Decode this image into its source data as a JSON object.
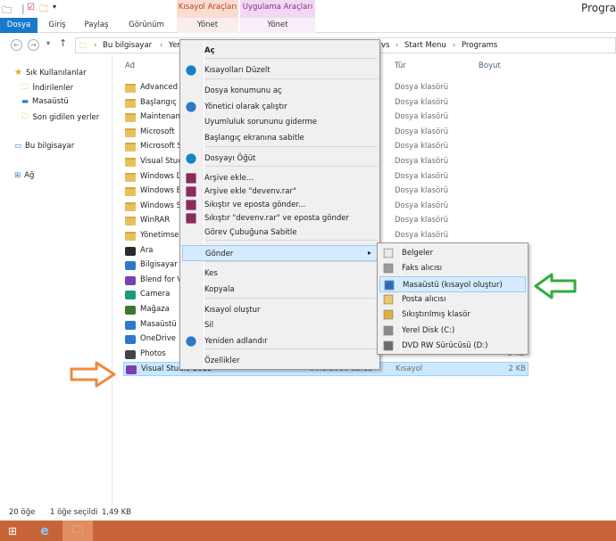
{
  "window": {
    "title": "Progra"
  },
  "ribbon": {
    "context1": "Kısayol Araçları",
    "context2": "Uygulama Araçları",
    "tabs": [
      "Dosya",
      "Giriş",
      "Paylaş",
      "Görünüm",
      "Yönet",
      "Yönet"
    ]
  },
  "address": {
    "crumbs": [
      "Bu bilgisayar",
      "Yer",
      "vs",
      "Start Menu",
      "Programs"
    ]
  },
  "nav": {
    "quick": "Sık Kullanılanlar",
    "items": [
      "İndirilenler",
      "Masaüstü",
      "Son gidilen yerler"
    ],
    "pc": "Bu bilgisayar",
    "network": "Ağ"
  },
  "columns": {
    "name": "Ad",
    "type": "Tür",
    "size": "Boyut"
  },
  "files": [
    {
      "name": "Advanced",
      "type": "Dosya klasörü",
      "kind": "folder"
    },
    {
      "name": "Başlangıç",
      "type": "Dosya klasörü",
      "kind": "folder"
    },
    {
      "name": "Maintenan",
      "type": "Dosya klasörü",
      "kind": "folder"
    },
    {
      "name": "Microsoft",
      "type": "Dosya klasörü",
      "kind": "folder"
    },
    {
      "name": "Microsoft S",
      "type": "Dosya klasörü",
      "kind": "folder"
    },
    {
      "name": "Visual Stud",
      "type": "Dosya klasörü",
      "kind": "folder"
    },
    {
      "name": "Windows D",
      "type": "Dosya klasörü",
      "kind": "folder"
    },
    {
      "name": "Windows E",
      "type": "Dosya klasörü",
      "kind": "folder"
    },
    {
      "name": "Windows S",
      "type": "Dosya klasörü",
      "kind": "folder"
    },
    {
      "name": "WinRAR",
      "type": "Dosya klasörü",
      "kind": "folder"
    },
    {
      "name": "Yönetimse",
      "type": "Dosya klasörü",
      "kind": "folder"
    },
    {
      "name": "Ara",
      "type": "",
      "kind": "app"
    },
    {
      "name": "Bilgisayar a",
      "type": "",
      "kind": "app"
    },
    {
      "name": "Blend for V",
      "type": "",
      "kind": "app"
    },
    {
      "name": "Camera",
      "type": "",
      "kind": "app"
    },
    {
      "name": "Mağaza",
      "type": "",
      "kind": "app"
    },
    {
      "name": "Masaüstü",
      "type": "",
      "kind": "app"
    },
    {
      "name": "OneDrive",
      "type": "",
      "kind": "app"
    },
    {
      "name": "Photos",
      "type": "",
      "kind": "app",
      "size": "3 KB"
    },
    {
      "name": "Visual Studio 2015",
      "type": "Kısayol",
      "kind": "app",
      "size": "2 KB",
      "date": "30.1.2016 12:15"
    }
  ],
  "context_menu": [
    "Aç",
    "Kısayolları Düzelt",
    "Dosya konumunu aç",
    "Yönetici olarak çalıştır",
    "Uyumluluk sorununu giderme",
    "Başlangıç ekranına sabitle",
    "Dosyayı Öğüt",
    "Arşive ekle...",
    "Arşive ekle \"devenv.rar\"",
    "Sıkıştır ve eposta gönder...",
    "Sıkıştır \"devenv.rar\" ve eposta gönder",
    "Görev Çubuğuna Sabitle",
    "Gönder",
    "Kes",
    "Kopyala",
    "Kısayol oluştur",
    "Sil",
    "Yeniden adlandır",
    "Özellikler"
  ],
  "sendto_menu": [
    "Belgeler",
    "Faks alıcısı",
    "Masaüstü (kısayol oluştur)",
    "Posta alıcısı",
    "Sıkıştırılmış klasör",
    "Yerel Disk (C:)",
    "DVD RW Sürücüsü (D:)"
  ],
  "status": {
    "count": "20 öğe",
    "selected": "1 öğe seçildi",
    "size": "1,49 KB"
  },
  "colors": {
    "accent": "#1979ca",
    "taskbar": "#c76437",
    "orange_arrow": "#f0883c",
    "green_arrow": "#2fae3a"
  }
}
